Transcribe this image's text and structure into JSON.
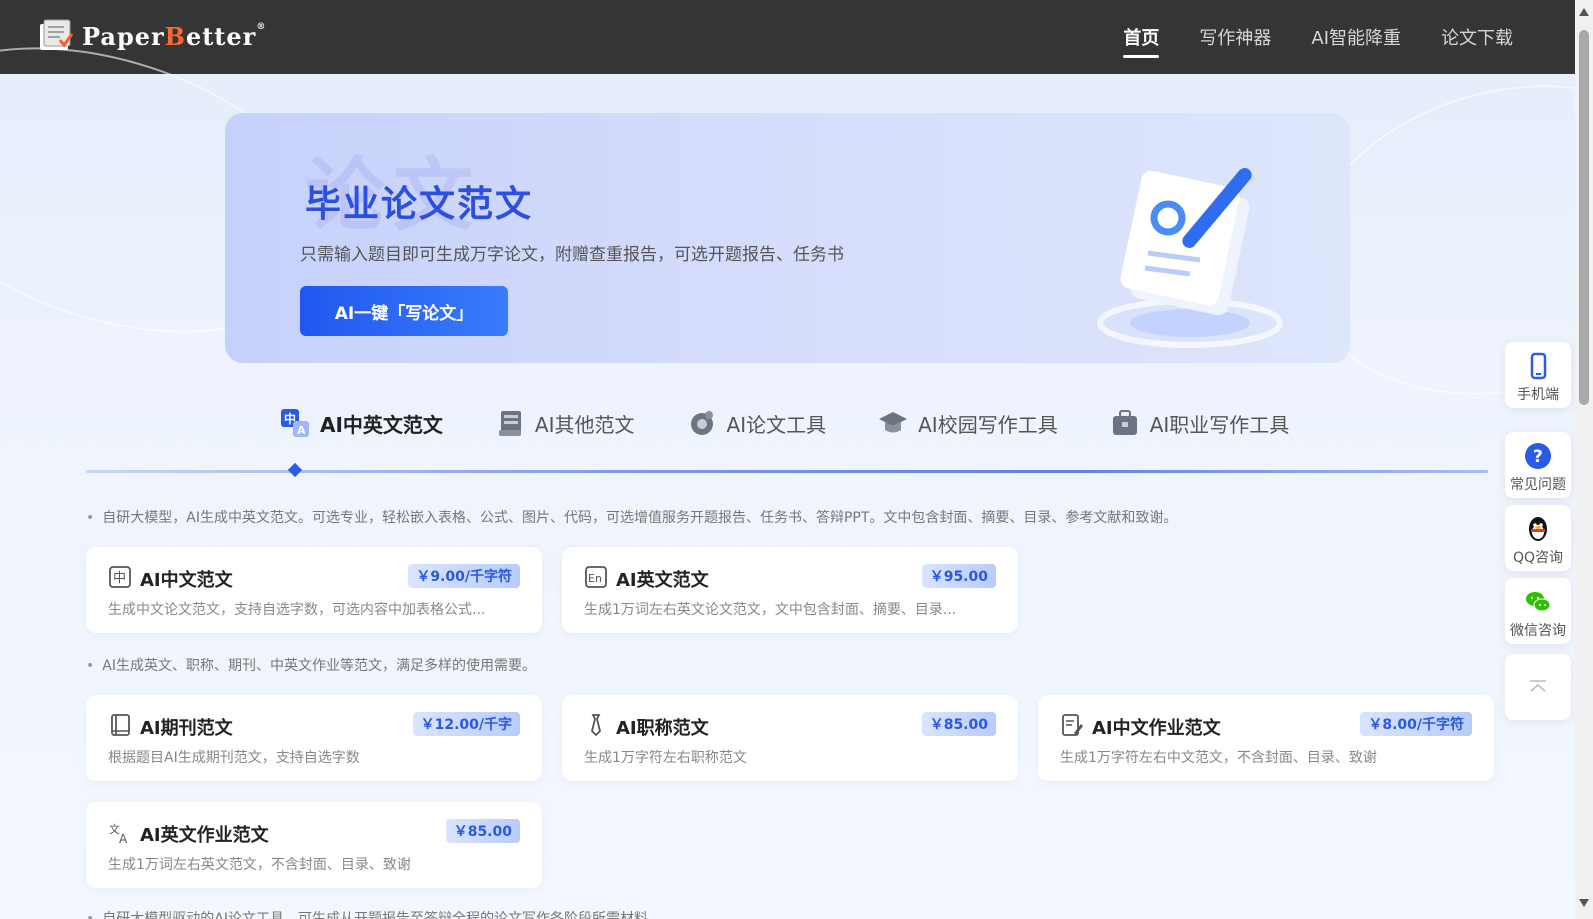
{
  "header": {
    "logo_prefix": "Paper",
    "logo_b": "B",
    "logo_suffix": "etter",
    "logo_reg": "®",
    "nav": [
      {
        "label": "首页",
        "active": true
      },
      {
        "label": "写作神器",
        "active": false
      },
      {
        "label": "AI智能降重",
        "active": false
      },
      {
        "label": "论文下载",
        "active": false
      }
    ]
  },
  "hero": {
    "watermark": "论文",
    "title": "毕业论文范文",
    "subtitle": "只需输入题目即可生成万字论文，附赠查重报告，可选开题报告、任务书",
    "button_label": "AI一键「写论文」"
  },
  "tabs": [
    {
      "label": "AI中英文范文",
      "icon": "translate-icon",
      "active": true
    },
    {
      "label": "AI其他范文",
      "icon": "document-stack-icon",
      "active": false
    },
    {
      "label": "AI论文工具",
      "icon": "gear-ai-icon",
      "active": false
    },
    {
      "label": "AI校园写作工具",
      "icon": "graduation-cap-icon",
      "active": false
    },
    {
      "label": "AI职业写作工具",
      "icon": "briefcase-icon",
      "active": false
    }
  ],
  "sections": {
    "s1_desc": "自研大模型，AI生成中英文范文。可选专业，轻松嵌入表格、公式、图片、代码，可选增值服务开题报告、任务书、答辩PPT。文中包含封面、摘要、目录、参考文献和致谢。",
    "s2_desc": "AI生成英文、职称、期刊、中英文作业等范文，满足多样的使用需要。",
    "s3_desc": "自研大模型驱动的AI论文工具，可生成从开题报告至答辩全程的论文写作各阶段所需材料。"
  },
  "cards": [
    {
      "title": "AI中文范文",
      "price": "￥9.00/千字符",
      "desc": "生成中文论文范文，支持自选字数，可选内容中加表格公式...",
      "icon": "chinese-char-icon"
    },
    {
      "title": "AI英文范文",
      "price": "￥95.00",
      "desc": "生成1万词左右英文论文范文，文中包含封面、摘要、目录...",
      "icon": "english-en-icon"
    },
    {
      "title": "AI期刊范文",
      "price": "￥12.00/千字",
      "desc": "根据题目AI生成期刊范文，支持自选字数",
      "icon": "book-icon"
    },
    {
      "title": "AI职称范文",
      "price": "￥85.00",
      "desc": "生成1万字符左右职称范文",
      "icon": "tie-icon"
    },
    {
      "title": "AI中文作业范文",
      "price": "￥8.00/千字符",
      "desc": "生成1万字符左右中文范文，不含封面、目录、致谢",
      "icon": "edit-document-icon"
    },
    {
      "title": "AI英文作业范文",
      "price": "￥85.00",
      "desc": "生成1万词左右英文范文，不含封面、目录、致谢",
      "icon": "translate-letter-icon"
    }
  ],
  "floats": {
    "mobile": "手机端",
    "faq": "常见问题",
    "qq": "QQ咨询",
    "wechat": "微信咨询"
  }
}
